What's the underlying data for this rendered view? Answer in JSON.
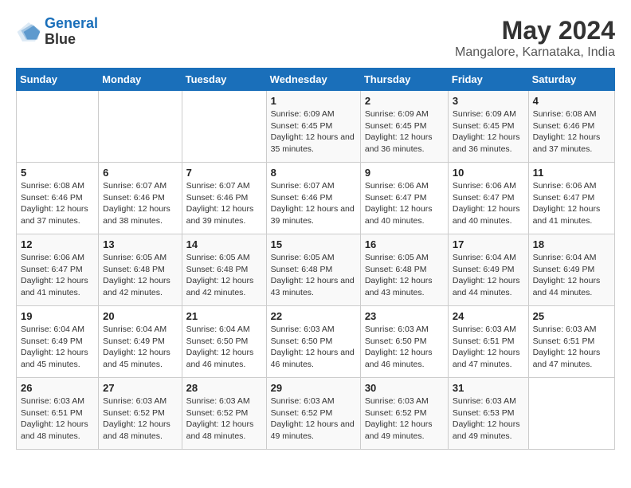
{
  "header": {
    "logo_line1": "General",
    "logo_line2": "Blue",
    "main_title": "May 2024",
    "subtitle": "Mangalore, Karnataka, India"
  },
  "days_of_week": [
    "Sunday",
    "Monday",
    "Tuesday",
    "Wednesday",
    "Thursday",
    "Friday",
    "Saturday"
  ],
  "weeks": [
    [
      {
        "day": "",
        "sunrise": "",
        "sunset": "",
        "daylight": ""
      },
      {
        "day": "",
        "sunrise": "",
        "sunset": "",
        "daylight": ""
      },
      {
        "day": "",
        "sunrise": "",
        "sunset": "",
        "daylight": ""
      },
      {
        "day": "1",
        "sunrise": "Sunrise: 6:09 AM",
        "sunset": "Sunset: 6:45 PM",
        "daylight": "Daylight: 12 hours and 35 minutes."
      },
      {
        "day": "2",
        "sunrise": "Sunrise: 6:09 AM",
        "sunset": "Sunset: 6:45 PM",
        "daylight": "Daylight: 12 hours and 36 minutes."
      },
      {
        "day": "3",
        "sunrise": "Sunrise: 6:09 AM",
        "sunset": "Sunset: 6:45 PM",
        "daylight": "Daylight: 12 hours and 36 minutes."
      },
      {
        "day": "4",
        "sunrise": "Sunrise: 6:08 AM",
        "sunset": "Sunset: 6:46 PM",
        "daylight": "Daylight: 12 hours and 37 minutes."
      }
    ],
    [
      {
        "day": "5",
        "sunrise": "Sunrise: 6:08 AM",
        "sunset": "Sunset: 6:46 PM",
        "daylight": "Daylight: 12 hours and 37 minutes."
      },
      {
        "day": "6",
        "sunrise": "Sunrise: 6:07 AM",
        "sunset": "Sunset: 6:46 PM",
        "daylight": "Daylight: 12 hours and 38 minutes."
      },
      {
        "day": "7",
        "sunrise": "Sunrise: 6:07 AM",
        "sunset": "Sunset: 6:46 PM",
        "daylight": "Daylight: 12 hours and 39 minutes."
      },
      {
        "day": "8",
        "sunrise": "Sunrise: 6:07 AM",
        "sunset": "Sunset: 6:46 PM",
        "daylight": "Daylight: 12 hours and 39 minutes."
      },
      {
        "day": "9",
        "sunrise": "Sunrise: 6:06 AM",
        "sunset": "Sunset: 6:47 PM",
        "daylight": "Daylight: 12 hours and 40 minutes."
      },
      {
        "day": "10",
        "sunrise": "Sunrise: 6:06 AM",
        "sunset": "Sunset: 6:47 PM",
        "daylight": "Daylight: 12 hours and 40 minutes."
      },
      {
        "day": "11",
        "sunrise": "Sunrise: 6:06 AM",
        "sunset": "Sunset: 6:47 PM",
        "daylight": "Daylight: 12 hours and 41 minutes."
      }
    ],
    [
      {
        "day": "12",
        "sunrise": "Sunrise: 6:06 AM",
        "sunset": "Sunset: 6:47 PM",
        "daylight": "Daylight: 12 hours and 41 minutes."
      },
      {
        "day": "13",
        "sunrise": "Sunrise: 6:05 AM",
        "sunset": "Sunset: 6:48 PM",
        "daylight": "Daylight: 12 hours and 42 minutes."
      },
      {
        "day": "14",
        "sunrise": "Sunrise: 6:05 AM",
        "sunset": "Sunset: 6:48 PM",
        "daylight": "Daylight: 12 hours and 42 minutes."
      },
      {
        "day": "15",
        "sunrise": "Sunrise: 6:05 AM",
        "sunset": "Sunset: 6:48 PM",
        "daylight": "Daylight: 12 hours and 43 minutes."
      },
      {
        "day": "16",
        "sunrise": "Sunrise: 6:05 AM",
        "sunset": "Sunset: 6:48 PM",
        "daylight": "Daylight: 12 hours and 43 minutes."
      },
      {
        "day": "17",
        "sunrise": "Sunrise: 6:04 AM",
        "sunset": "Sunset: 6:49 PM",
        "daylight": "Daylight: 12 hours and 44 minutes."
      },
      {
        "day": "18",
        "sunrise": "Sunrise: 6:04 AM",
        "sunset": "Sunset: 6:49 PM",
        "daylight": "Daylight: 12 hours and 44 minutes."
      }
    ],
    [
      {
        "day": "19",
        "sunrise": "Sunrise: 6:04 AM",
        "sunset": "Sunset: 6:49 PM",
        "daylight": "Daylight: 12 hours and 45 minutes."
      },
      {
        "day": "20",
        "sunrise": "Sunrise: 6:04 AM",
        "sunset": "Sunset: 6:49 PM",
        "daylight": "Daylight: 12 hours and 45 minutes."
      },
      {
        "day": "21",
        "sunrise": "Sunrise: 6:04 AM",
        "sunset": "Sunset: 6:50 PM",
        "daylight": "Daylight: 12 hours and 46 minutes."
      },
      {
        "day": "22",
        "sunrise": "Sunrise: 6:03 AM",
        "sunset": "Sunset: 6:50 PM",
        "daylight": "Daylight: 12 hours and 46 minutes."
      },
      {
        "day": "23",
        "sunrise": "Sunrise: 6:03 AM",
        "sunset": "Sunset: 6:50 PM",
        "daylight": "Daylight: 12 hours and 46 minutes."
      },
      {
        "day": "24",
        "sunrise": "Sunrise: 6:03 AM",
        "sunset": "Sunset: 6:51 PM",
        "daylight": "Daylight: 12 hours and 47 minutes."
      },
      {
        "day": "25",
        "sunrise": "Sunrise: 6:03 AM",
        "sunset": "Sunset: 6:51 PM",
        "daylight": "Daylight: 12 hours and 47 minutes."
      }
    ],
    [
      {
        "day": "26",
        "sunrise": "Sunrise: 6:03 AM",
        "sunset": "Sunset: 6:51 PM",
        "daylight": "Daylight: 12 hours and 48 minutes."
      },
      {
        "day": "27",
        "sunrise": "Sunrise: 6:03 AM",
        "sunset": "Sunset: 6:52 PM",
        "daylight": "Daylight: 12 hours and 48 minutes."
      },
      {
        "day": "28",
        "sunrise": "Sunrise: 6:03 AM",
        "sunset": "Sunset: 6:52 PM",
        "daylight": "Daylight: 12 hours and 48 minutes."
      },
      {
        "day": "29",
        "sunrise": "Sunrise: 6:03 AM",
        "sunset": "Sunset: 6:52 PM",
        "daylight": "Daylight: 12 hours and 49 minutes."
      },
      {
        "day": "30",
        "sunrise": "Sunrise: 6:03 AM",
        "sunset": "Sunset: 6:52 PM",
        "daylight": "Daylight: 12 hours and 49 minutes."
      },
      {
        "day": "31",
        "sunrise": "Sunrise: 6:03 AM",
        "sunset": "Sunset: 6:53 PM",
        "daylight": "Daylight: 12 hours and 49 minutes."
      },
      {
        "day": "",
        "sunrise": "",
        "sunset": "",
        "daylight": ""
      }
    ]
  ]
}
